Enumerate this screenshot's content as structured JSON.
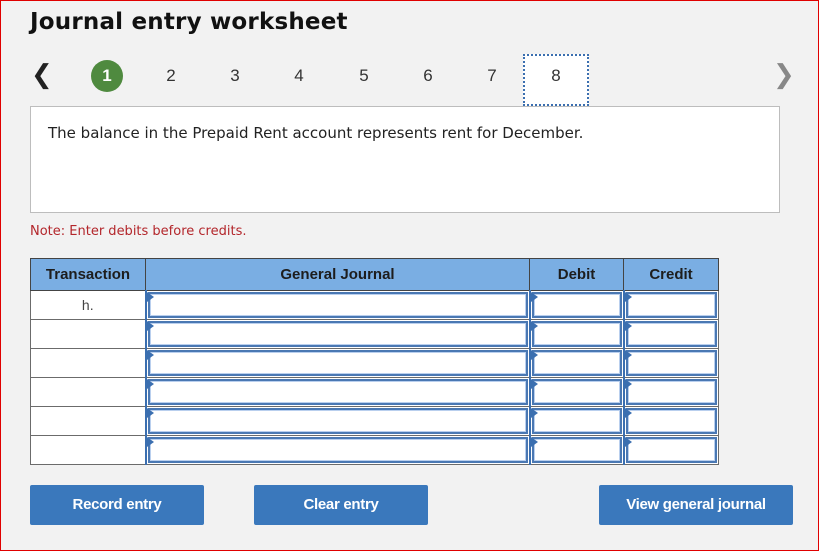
{
  "header": {
    "title": "Journal entry worksheet"
  },
  "pager": {
    "prev_icon": "‹",
    "next_icon": "›",
    "pages": [
      "1",
      "2",
      "3",
      "4",
      "5",
      "6",
      "7",
      "8"
    ],
    "completed_page": "1",
    "current_page": "8"
  },
  "description": "The balance in the Prepaid Rent account represents rent for December.",
  "note": "Note: Enter debits before credits.",
  "table": {
    "headers": {
      "transaction": "Transaction",
      "general_journal": "General Journal",
      "debit": "Debit",
      "credit": "Credit"
    },
    "rows": [
      {
        "transaction": "h.",
        "account": "",
        "debit": "",
        "credit": ""
      },
      {
        "transaction": "",
        "account": "",
        "debit": "",
        "credit": ""
      },
      {
        "transaction": "",
        "account": "",
        "debit": "",
        "credit": ""
      },
      {
        "transaction": "",
        "account": "",
        "debit": "",
        "credit": ""
      },
      {
        "transaction": "",
        "account": "",
        "debit": "",
        "credit": ""
      },
      {
        "transaction": "",
        "account": "",
        "debit": "",
        "credit": ""
      }
    ]
  },
  "buttons": {
    "record": "Record entry",
    "clear": "Clear entry",
    "view": "View general journal"
  },
  "colors": {
    "accent": "#3a78bc",
    "completed": "#4f8a3f",
    "header_bg": "#7aaee3",
    "note": "#b3262b",
    "frame": "#e00000"
  }
}
